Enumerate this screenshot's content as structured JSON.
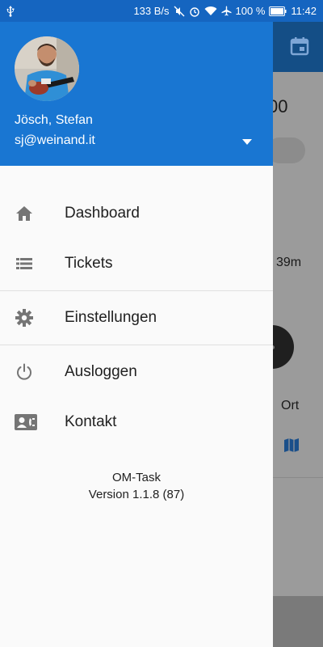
{
  "statusbar": {
    "net_speed": "133 B/s",
    "battery_pct": "100 %",
    "time": "11:42"
  },
  "background": {
    "partial_value": "00",
    "duration": "39m",
    "ort_label": "Ort"
  },
  "drawer": {
    "user": {
      "name": "Jösch, Stefan",
      "email": "sj@weinand.it"
    },
    "menu": [
      {
        "label": "Dashboard",
        "icon": "home-icon"
      },
      {
        "label": "Tickets",
        "icon": "list-icon"
      },
      {
        "label": "Einstellungen",
        "icon": "gear-icon"
      },
      {
        "label": "Ausloggen",
        "icon": "power-icon"
      },
      {
        "label": "Kontakt",
        "icon": "contact-card-icon"
      }
    ],
    "app_name": "OM-Task",
    "version": "Version 1.1.8 (87)"
  },
  "colors": {
    "header_blue": "#1976d2",
    "statusbar_blue": "#1565c0",
    "icon_grey": "#757575"
  }
}
